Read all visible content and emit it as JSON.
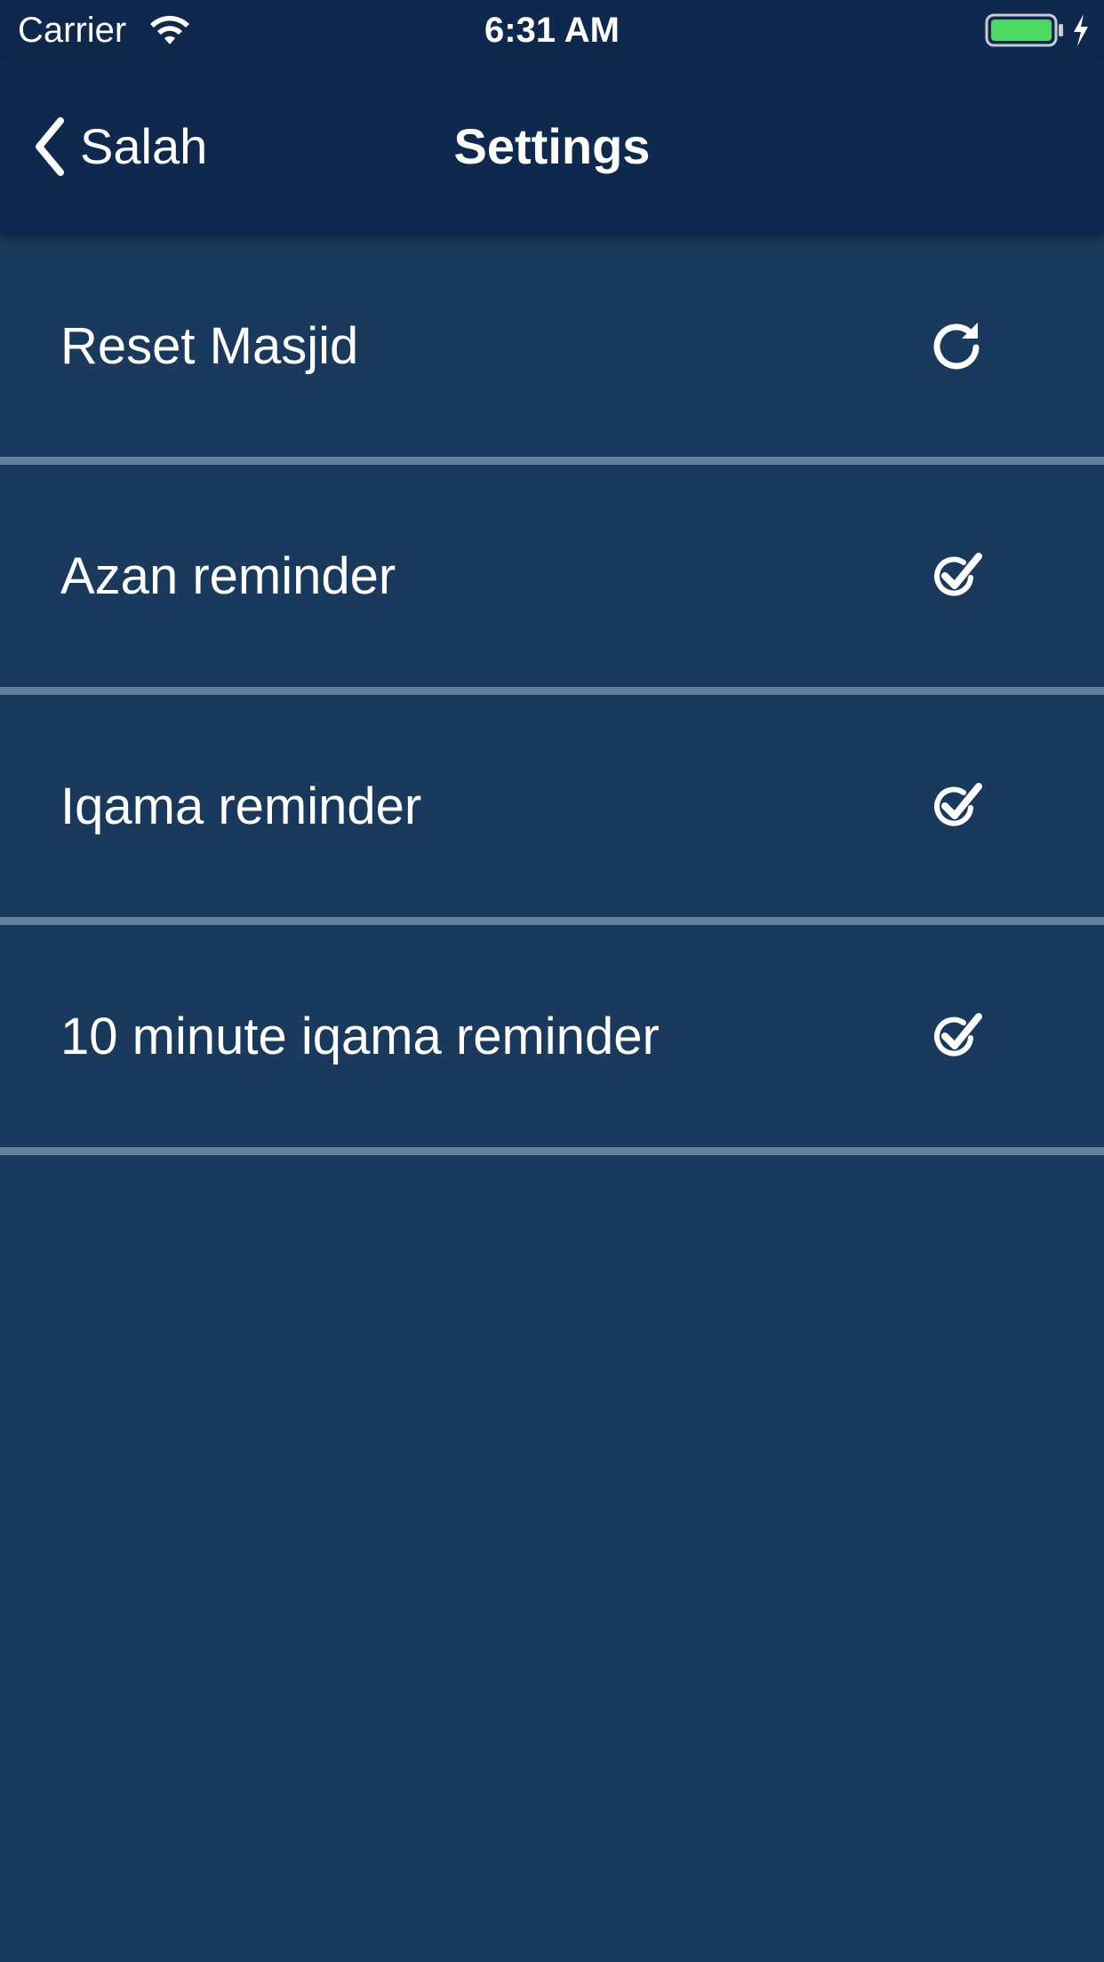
{
  "status_bar": {
    "carrier": "Carrier",
    "time": "6:31 AM",
    "battery_color": "#4cd964"
  },
  "nav": {
    "back_label": "Salah",
    "title": "Settings"
  },
  "settings": [
    {
      "label": "Reset Masjid",
      "icon": "refresh-icon"
    },
    {
      "label": "Azan reminder",
      "icon": "check-circle-icon"
    },
    {
      "label": "Iqama reminder",
      "icon": "check-circle-icon"
    },
    {
      "label": "10 minute iqama reminder",
      "icon": "check-circle-icon"
    }
  ],
  "colors": {
    "nav_background": "#0f284e",
    "content_background": "#193a5c",
    "divider": "#61809c",
    "text": "#ffffff"
  }
}
